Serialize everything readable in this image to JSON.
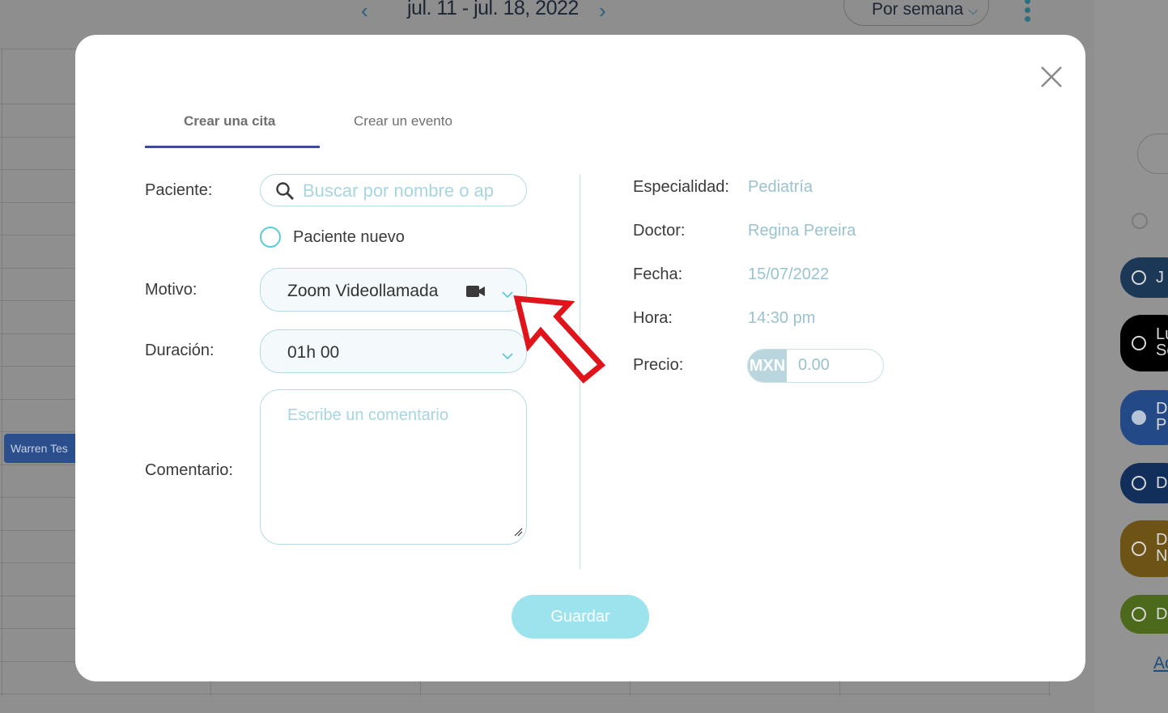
{
  "background": {
    "date_range": "jul. 11 - jul. 18, 2022",
    "view_selector": "Por semana",
    "event_label": "Warren Tes",
    "side_items": [
      "J",
      "Lu So",
      "D P",
      "D",
      "D N",
      "D"
    ],
    "side_link": "Ac"
  },
  "modal": {
    "tabs": [
      {
        "label": "Crear una cita",
        "active": true
      },
      {
        "label": "Crear un evento",
        "active": false
      }
    ],
    "patient_label": "Paciente:",
    "patient_search_placeholder": "Buscar por nombre o ap",
    "new_patient_label": "Paciente nuevo",
    "reason_label": "Motivo:",
    "reason_value": "Zoom Videollamada",
    "duration_label": "Duración:",
    "duration_value": "01h 00",
    "comment_label": "Comentario:",
    "comment_placeholder": "Escribe un comentario",
    "specialty_label": "Especialidad:",
    "specialty_value": "Pediatría",
    "doctor_label": "Doctor:",
    "doctor_value": "Regina Pereira",
    "date_label": "Fecha:",
    "date_value": "15/07/2022",
    "time_label": "Hora:",
    "time_value": "14:30 pm",
    "price_label": "Precio:",
    "currency": "MXN",
    "price_value": "0.00",
    "save_label": "Guardar"
  },
  "colors": {
    "accent": "#5fcad7",
    "tab_underline": "#3e4a9a",
    "save_button": "#9ce3ee",
    "annotation_arrow": "#e0151c"
  }
}
